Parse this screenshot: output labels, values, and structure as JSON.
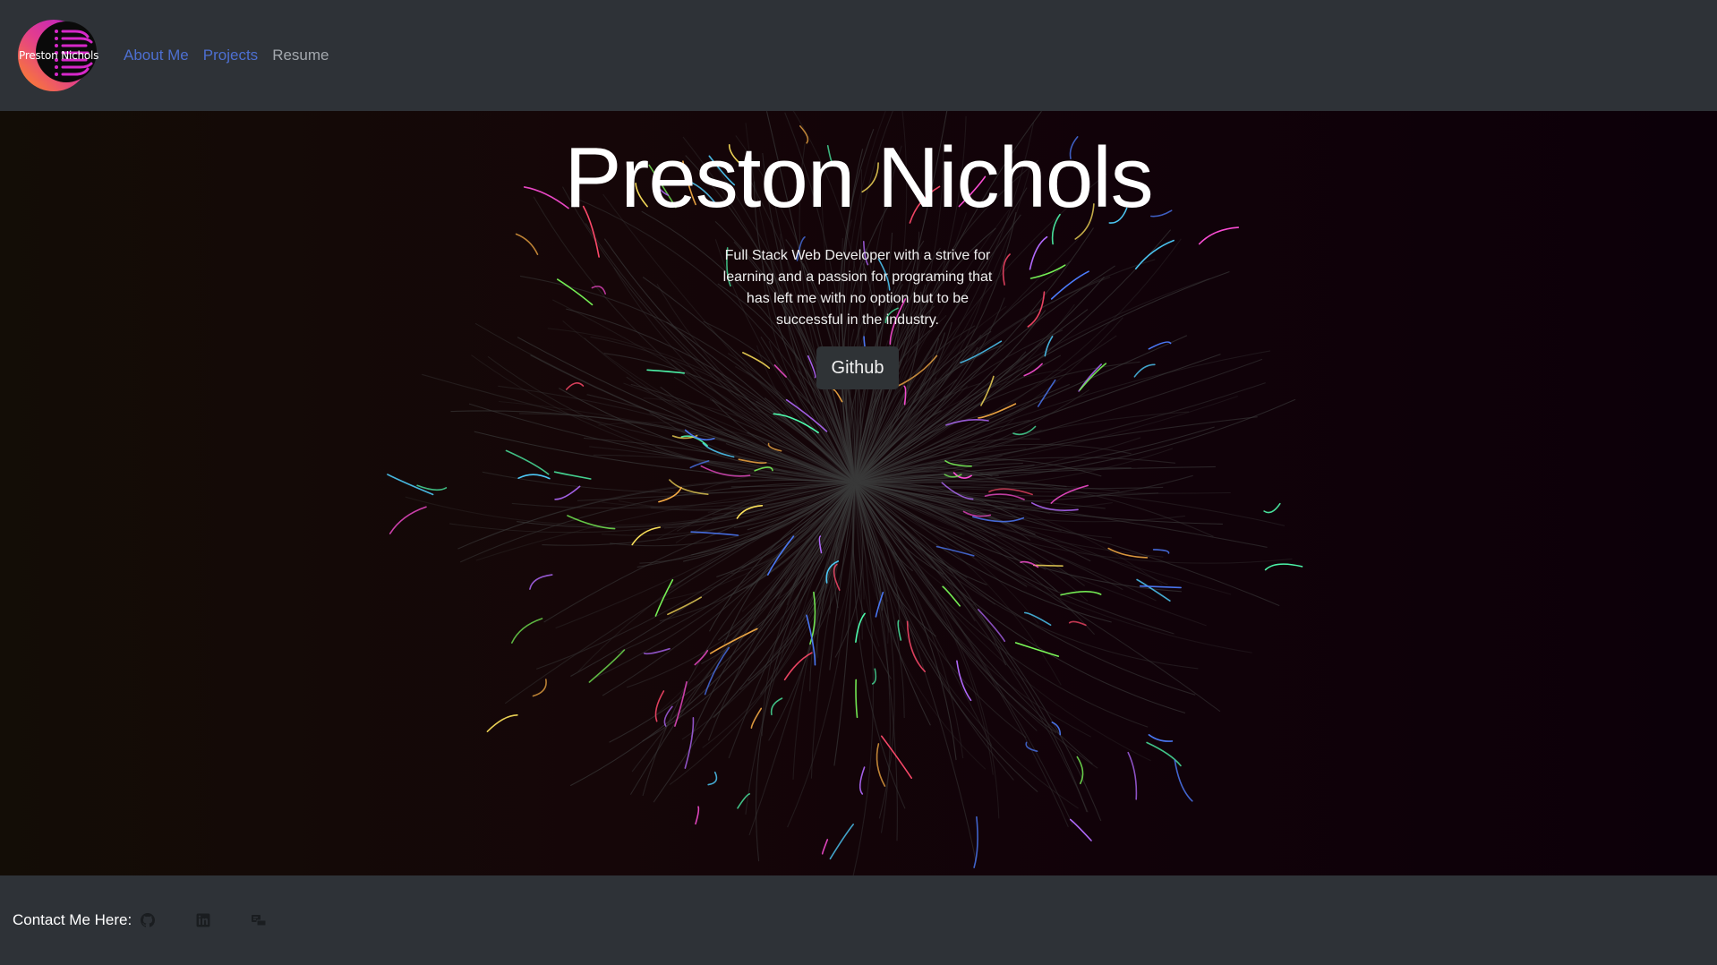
{
  "navbar": {
    "logo_text": "Preston Nichols",
    "links": [
      {
        "label": "About Me",
        "style": "primary"
      },
      {
        "label": "Projects",
        "style": "primary"
      },
      {
        "label": "Resume",
        "style": "muted"
      }
    ]
  },
  "hero": {
    "title": "Preston Nichols",
    "description": "Full Stack Web Developer with a strive for learning and a passion for programing that has left me with no option but to be successful in the industry.",
    "button_label": "Github"
  },
  "footer": {
    "contact_label": "Contact Me Here:",
    "icons": [
      "github-icon",
      "linkedin-icon",
      "contact-card-icon"
    ]
  },
  "colors": {
    "navbar_bg": "#2e3237",
    "link_primary": "#4d6fd1",
    "link_muted": "#a3a8ae",
    "button_bg": "#2f3336",
    "streak_colors": [
      "#7cff5a",
      "#ff4fd8",
      "#4fd0ff",
      "#ffb347",
      "#b36bff",
      "#ffe45c",
      "#4d7dff",
      "#ff4a6b",
      "#4fffb0"
    ]
  }
}
